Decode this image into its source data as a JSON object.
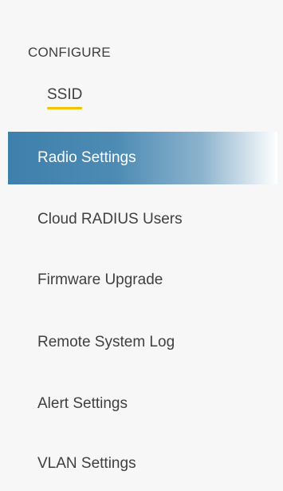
{
  "sidebar": {
    "section_heading": "CONFIGURE",
    "ssid_label": "SSID",
    "items": [
      {
        "label": "Radio Settings"
      },
      {
        "label": "Cloud RADIUS Users"
      },
      {
        "label": "Firmware Upgrade"
      },
      {
        "label": "Remote System Log"
      },
      {
        "label": "Alert Settings"
      },
      {
        "label": "VLAN Settings"
      }
    ]
  },
  "colors": {
    "active_bg": "#3e80ac",
    "active_text": "#ffffff",
    "underline": "#f4c400",
    "text": "#3f3f3f",
    "sidebar_bg": "#f7f7f7"
  }
}
